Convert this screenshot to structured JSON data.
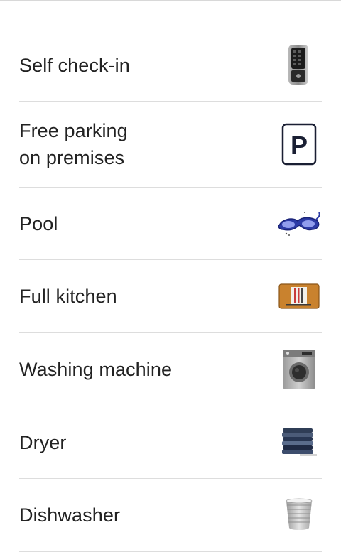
{
  "amenities": [
    {
      "label": "Self check-in",
      "icon": "smart-lock-icon"
    },
    {
      "label": "Free parking\non premises",
      "icon": "parking-sign-icon"
    },
    {
      "label": "Pool",
      "icon": "swim-goggles-icon"
    },
    {
      "label": "Full kitchen",
      "icon": "cutting-board-icon"
    },
    {
      "label": "Washing machine",
      "icon": "washing-machine-icon"
    },
    {
      "label": "Dryer",
      "icon": "folded-towels-icon"
    },
    {
      "label": "Dishwasher",
      "icon": "stacked-bowls-icon"
    }
  ],
  "parking_letter": "P"
}
